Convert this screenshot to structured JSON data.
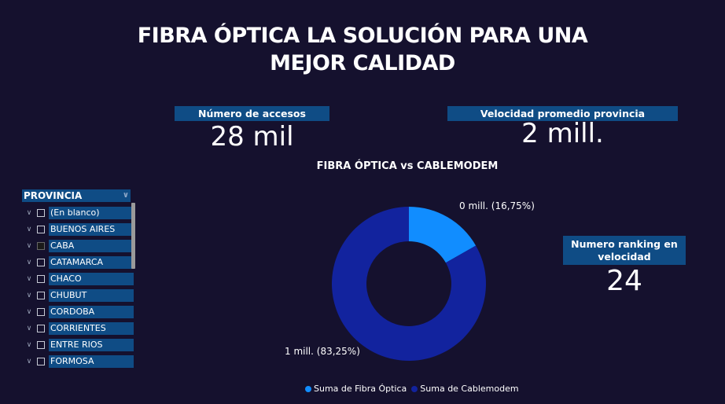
{
  "title": {
    "line1": "FIBRA ÓPTICA LA SOLUCIÓN PARA UNA",
    "line2": "MEJOR CALIDAD"
  },
  "cards": {
    "accesos": {
      "label": "Número de accesos",
      "value": "28 mil"
    },
    "velocidad": {
      "label": "Velocidad promedio provincia",
      "value": "2 mill."
    },
    "ranking": {
      "label": "Numero ranking en velocidad",
      "value": "24"
    }
  },
  "slicer": {
    "header": "PROVINCIA",
    "items": [
      {
        "label": "(En blanco)"
      },
      {
        "label": "BUENOS AIRES"
      },
      {
        "label": "CABA"
      },
      {
        "label": "CATAMARCA"
      },
      {
        "label": "CHACO"
      },
      {
        "label": "CHUBUT"
      },
      {
        "label": "CORDOBA"
      },
      {
        "label": "CORRIENTES"
      },
      {
        "label": "ENTRE RIOS"
      },
      {
        "label": "FORMOSA"
      }
    ]
  },
  "chart_data": {
    "type": "pie",
    "title": "FIBRA ÓPTICA vs CABLEMODEM",
    "series": [
      {
        "name": "Suma de Fibra Óptica",
        "percent": 16.75,
        "label": "0 mill. (16,75%)",
        "color": "#118dff"
      },
      {
        "name": "Suma de Cablemodem",
        "percent": 83.25,
        "label": "1 mill. (83,25%)",
        "color": "#12239e"
      }
    ],
    "legend_position": "bottom"
  }
}
